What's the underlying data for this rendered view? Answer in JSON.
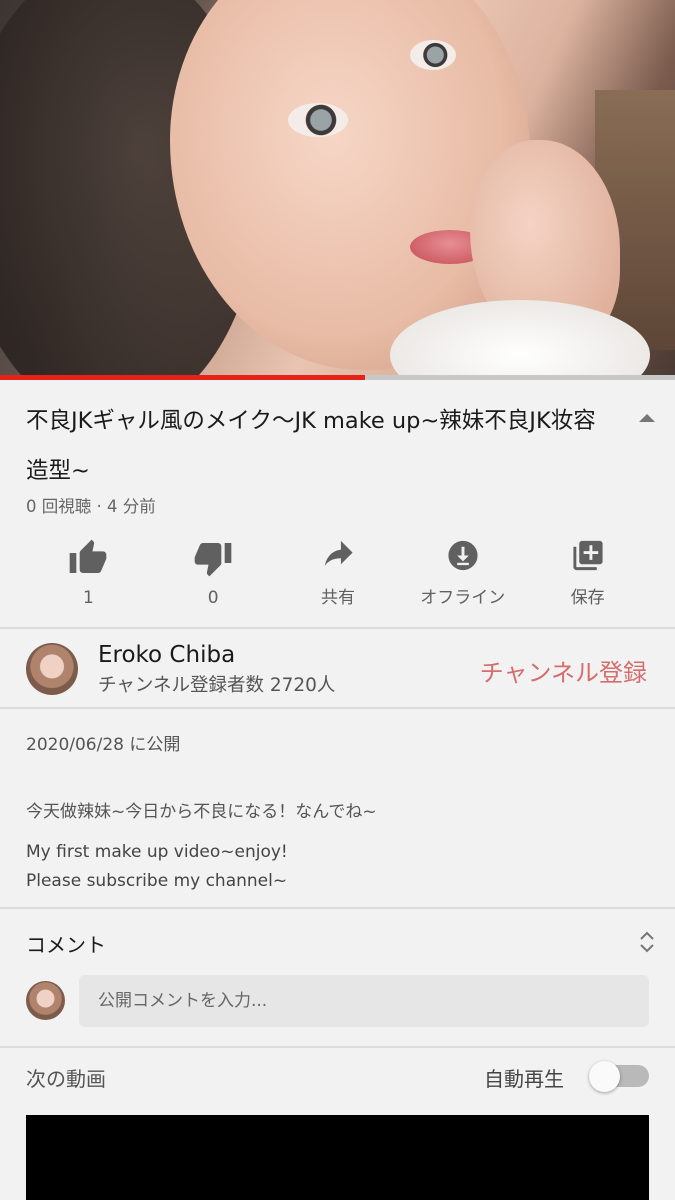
{
  "player": {
    "progress": 0.54,
    "accent": "#e62117"
  },
  "video": {
    "title": "不良JKギャル風のメイク〜JK make up~辣妹不良JK妆容造型~",
    "meta": "0 回視聴 · 4 分前"
  },
  "actions": [
    {
      "icon": "thumbs-up-icon",
      "label": "1"
    },
    {
      "icon": "thumbs-down-icon",
      "label": "0"
    },
    {
      "icon": "share-icon",
      "label": "共有"
    },
    {
      "icon": "download-icon",
      "label": "オフライン"
    },
    {
      "icon": "playlist-add-icon",
      "label": "保存"
    }
  ],
  "channel": {
    "name": "Eroko Chiba",
    "subscribers": "チャンネル登録者数 2720人",
    "subscribe_label": "チャンネル登録",
    "subscribe_color": "#d66d6d"
  },
  "description": {
    "published": "2020/06/28 に公開",
    "line1": "今天做辣妹~今日から不良になる！なんでね~",
    "line2": "My first make up video~enjoy!",
    "line3": "Please subscribe my channel~"
  },
  "comments": {
    "title": "コメント",
    "input_placeholder": "公開コメントを入力..."
  },
  "up_next": {
    "title": "次の動画",
    "autoplay_label": "自動再生",
    "autoplay_on": false
  }
}
